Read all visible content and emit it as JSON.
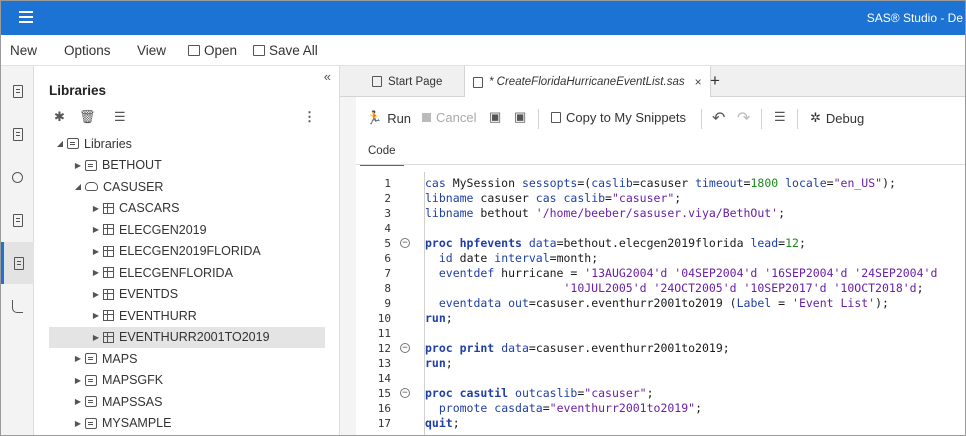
{
  "app": {
    "title": "SAS® Studio - De"
  },
  "menu": {
    "new": "New",
    "options": "Options",
    "view": "View",
    "open": "Open",
    "save_all": "Save All"
  },
  "libraries": {
    "title": "Libraries",
    "tree": [
      {
        "label": "Libraries",
        "indent": 0,
        "caret": "◢",
        "icon": "lib"
      },
      {
        "label": "BETHOUT",
        "indent": 1,
        "caret": "▶",
        "icon": "lib"
      },
      {
        "label": "CASUSER",
        "indent": 1,
        "caret": "◢",
        "icon": "cloud"
      },
      {
        "label": "CASCARS",
        "indent": 2,
        "caret": "▶",
        "icon": "table"
      },
      {
        "label": "ELECGEN2019",
        "indent": 2,
        "caret": "▶",
        "icon": "table"
      },
      {
        "label": "ELECGEN2019FLORIDA",
        "indent": 2,
        "caret": "▶",
        "icon": "table"
      },
      {
        "label": "ELECGENFLORIDA",
        "indent": 2,
        "caret": "▶",
        "icon": "table"
      },
      {
        "label": "EVENTDS",
        "indent": 2,
        "caret": "▶",
        "icon": "table"
      },
      {
        "label": "EVENTHURR",
        "indent": 2,
        "caret": "▶",
        "icon": "table"
      },
      {
        "label": "EVENTHURR2001TO2019",
        "indent": 2,
        "caret": "▶",
        "icon": "table",
        "selected": true
      },
      {
        "label": "MAPS",
        "indent": 1,
        "caret": "▶",
        "icon": "lib"
      },
      {
        "label": "MAPSGFK",
        "indent": 1,
        "caret": "▶",
        "icon": "lib"
      },
      {
        "label": "MAPSSAS",
        "indent": 1,
        "caret": "▶",
        "icon": "lib"
      },
      {
        "label": "MYSAMPLE",
        "indent": 1,
        "caret": "▶",
        "icon": "lib"
      }
    ]
  },
  "tabs": {
    "start_page": "Start Page",
    "program": "* CreateFloridaHurricaneEventList.sas",
    "close": "×",
    "add": "+"
  },
  "toolbar": {
    "run": "Run",
    "cancel": "Cancel",
    "copy_snippets": "Copy to My Snippets",
    "debug": "Debug"
  },
  "code_tab": "Code",
  "code": {
    "line_numbers": [
      "1",
      "2",
      "3",
      "4",
      "5",
      "6",
      "7",
      "8",
      "9",
      "10",
      "11",
      "12",
      "13",
      "14",
      "15",
      "16",
      "17"
    ],
    "fold_lines": [
      5,
      12,
      15
    ],
    "lines": [
      [
        [
          "cas",
          "kw2"
        ],
        [
          " MySession ",
          ""
        ],
        [
          "sessopts",
          "kw2"
        ],
        [
          "=(",
          ""
        ],
        [
          "caslib",
          "kw2"
        ],
        [
          "=casuser ",
          ""
        ],
        [
          "timeout",
          "kw2"
        ],
        [
          "=",
          ""
        ],
        [
          "1800",
          "num"
        ],
        [
          " ",
          ""
        ],
        [
          "locale",
          "kw2"
        ],
        [
          "=",
          ""
        ],
        [
          "\"en_US\"",
          "str"
        ],
        [
          ");",
          ""
        ]
      ],
      [
        [
          "libname",
          "kw2"
        ],
        [
          " casuser ",
          ""
        ],
        [
          "cas",
          "kw2"
        ],
        [
          " ",
          ""
        ],
        [
          "caslib",
          "kw2"
        ],
        [
          "=",
          ""
        ],
        [
          "\"casuser\"",
          "str"
        ],
        [
          ";",
          ""
        ]
      ],
      [
        [
          "libname",
          "kw2"
        ],
        [
          " bethout ",
          ""
        ],
        [
          "'/home/beeber/sasuser.viya/BethOut'",
          "str"
        ],
        [
          ";",
          ""
        ]
      ],
      [
        [
          "",
          ""
        ]
      ],
      [
        [
          "proc hpfevents",
          "kw"
        ],
        [
          " ",
          ""
        ],
        [
          "data",
          "kw2"
        ],
        [
          "=bethout.elecgen2019florida ",
          ""
        ],
        [
          "lead",
          "kw2"
        ],
        [
          "=",
          ""
        ],
        [
          "12",
          "num"
        ],
        [
          ";",
          ""
        ]
      ],
      [
        [
          "  ",
          ""
        ],
        [
          "id",
          "kw2"
        ],
        [
          " date ",
          ""
        ],
        [
          "interval",
          "kw2"
        ],
        [
          "=month;",
          ""
        ]
      ],
      [
        [
          "  ",
          ""
        ],
        [
          "eventdef",
          "kw2"
        ],
        [
          " hurricane = ",
          ""
        ],
        [
          "'13AUG2004'd '04SEP2004'd '16SEP2004'd '24SEP2004'd",
          "str"
        ]
      ],
      [
        [
          "                    ",
          ""
        ],
        [
          "'10JUL2005'd '24OCT2005'd '10SEP2017'd '10OCT2018'd",
          "str"
        ],
        [
          ";",
          ""
        ]
      ],
      [
        [
          "  ",
          ""
        ],
        [
          "eventdata",
          "kw2"
        ],
        [
          " ",
          ""
        ],
        [
          "out",
          "kw2"
        ],
        [
          "=casuser.eventhurr2001to2019 (",
          ""
        ],
        [
          "Label",
          "kw2"
        ],
        [
          " = ",
          ""
        ],
        [
          "'Event List'",
          "str"
        ],
        [
          ");",
          ""
        ]
      ],
      [
        [
          "run",
          "kw"
        ],
        [
          ";",
          ""
        ]
      ],
      [
        [
          "",
          ""
        ]
      ],
      [
        [
          "proc print",
          "kw"
        ],
        [
          " ",
          ""
        ],
        [
          "data",
          "kw2"
        ],
        [
          "=casuser.eventhurr2001to2019;",
          ""
        ]
      ],
      [
        [
          "run",
          "kw"
        ],
        [
          ";",
          ""
        ]
      ],
      [
        [
          "",
          ""
        ]
      ],
      [
        [
          "proc casutil",
          "kw"
        ],
        [
          " ",
          ""
        ],
        [
          "outcaslib",
          "kw2"
        ],
        [
          "=",
          ""
        ],
        [
          "\"casuser\"",
          "str"
        ],
        [
          ";",
          ""
        ]
      ],
      [
        [
          "  ",
          ""
        ],
        [
          "promote",
          "kw2"
        ],
        [
          " ",
          ""
        ],
        [
          "casdata",
          "kw2"
        ],
        [
          "=",
          ""
        ],
        [
          "\"eventhurr2001to2019\"",
          "str"
        ],
        [
          ";",
          ""
        ]
      ],
      [
        [
          "quit",
          "kw"
        ],
        [
          ";",
          ""
        ]
      ]
    ]
  },
  "colors": {
    "accent": "#1d73d3",
    "keyword": "#1f3fa6",
    "string": "#6a1fa8",
    "number": "#1a8a1a"
  },
  "icons": [
    "menu-icon",
    "folder-icon",
    "save-icon",
    "collapse-icon",
    "new-library-icon",
    "delete-icon",
    "properties-icon",
    "more-icon",
    "run-icon",
    "cancel-icon",
    "undo-icon",
    "redo-icon",
    "debug-icon"
  ]
}
